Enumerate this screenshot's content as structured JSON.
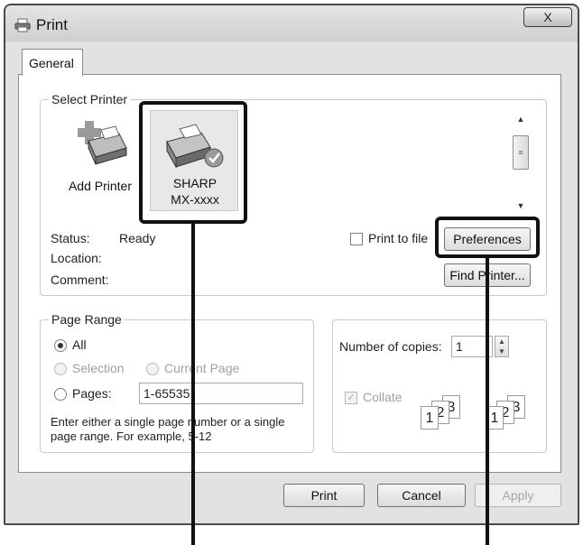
{
  "window": {
    "title": "Print",
    "close_glyph": "X"
  },
  "tabs": [
    {
      "label": "General"
    }
  ],
  "select_printer": {
    "group_label": "Select Printer",
    "printers": [
      {
        "name": "Add Printer",
        "icon": "add-printer-icon",
        "selected": false
      },
      {
        "name_line1": "SHARP",
        "name_line2": "MX-xxxx",
        "icon": "printer-icon",
        "selected": true
      }
    ],
    "status_label": "Status:",
    "status_value": "Ready",
    "location_label": "Location:",
    "comment_label": "Comment:",
    "print_to_file_label": "Print to file",
    "print_to_file_checked": false,
    "preferences_button": "Preferences",
    "find_printer_button": "Find Printer..."
  },
  "page_range": {
    "group_label": "Page Range",
    "all_label": "All",
    "selection_label": "Selection",
    "current_page_label": "Current Page",
    "pages_label": "Pages:",
    "pages_value": "1-65535",
    "hint_line1": "Enter either a single page number or a single",
    "hint_line2": "page range.  For example, 5-12",
    "selected_option": "All"
  },
  "copies": {
    "number_label": "Number of copies:",
    "number_value": "1",
    "collate_label": "Collate",
    "collate_checked": true,
    "collate_disabled": true,
    "collate_pages": [
      "1",
      "2",
      "3"
    ]
  },
  "footer": {
    "print_button": "Print",
    "cancel_button": "Cancel",
    "apply_button": "Apply"
  },
  "colors": {
    "frame": "#4a4a4a",
    "dialog_bg": "#e2e2e2",
    "annotation": "#111111"
  }
}
